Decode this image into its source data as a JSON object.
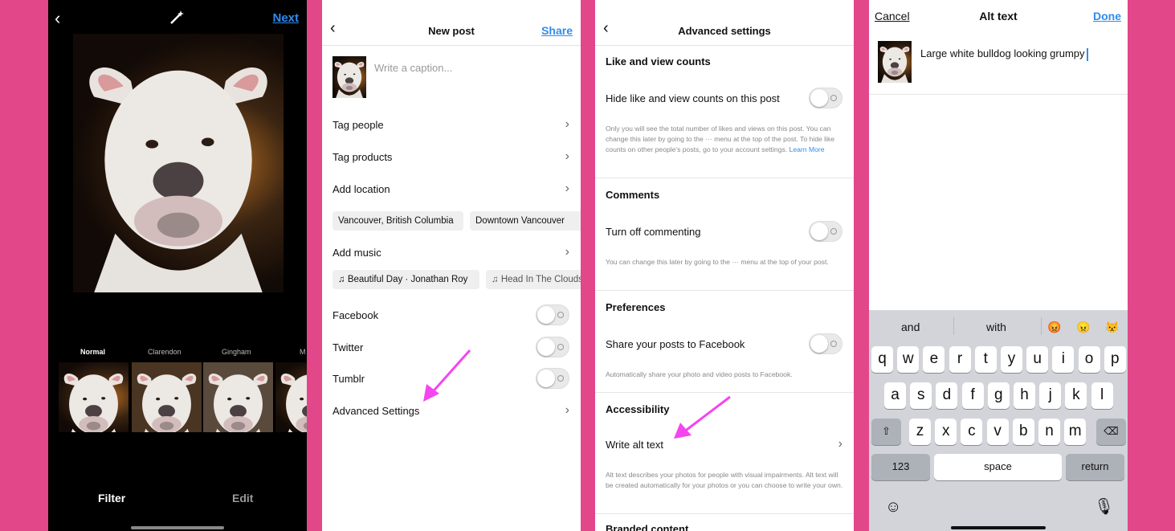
{
  "filter_screen": {
    "next_label": "Next",
    "filters": [
      "Normal",
      "Clarendon",
      "Gingham",
      "M"
    ],
    "tabs": [
      "Filter",
      "Edit"
    ]
  },
  "new_post": {
    "title": "New post",
    "share_label": "Share",
    "caption_placeholder": "Write a caption...",
    "rows": {
      "tag_people": "Tag people",
      "tag_products": "Tag products",
      "add_location": "Add location",
      "add_music": "Add music",
      "facebook": "Facebook",
      "twitter": "Twitter",
      "tumblr": "Tumblr",
      "advanced": "Advanced Settings"
    },
    "location_chips": [
      "Vancouver, British Columbia",
      "Downtown Vancouver"
    ],
    "music_chips": [
      "Beautiful Day · Jonathan Roy",
      "Head In The Clouds"
    ]
  },
  "advanced_settings": {
    "title": "Advanced settings",
    "like_counts": {
      "heading": "Like and view counts",
      "row": "Hide like and view counts on this post",
      "note": "Only you will see the total number of likes and views on this post. You can change this later by going to the ··· menu at the top of the post. To hide like counts on other people's posts, go to your account settings.",
      "link": "Learn More"
    },
    "comments": {
      "heading": "Comments",
      "row": "Turn off commenting",
      "note": "You can change this later by going to the ··· menu at the top of your post."
    },
    "preferences": {
      "heading": "Preferences",
      "row": "Share your posts to Facebook",
      "note": "Automatically share your photo and video posts to Facebook."
    },
    "accessibility": {
      "heading": "Accessibility",
      "row": "Write alt text",
      "note": "Alt text describes your photos for people with visual impairments. Alt text will be created automatically for your photos or you can choose to write your own."
    },
    "branded": {
      "heading": "Branded content"
    }
  },
  "alt_text": {
    "cancel_label": "Cancel",
    "title": "Alt text",
    "done_label": "Done",
    "value": "Large white bulldog looking grumpy",
    "suggestions": [
      "and",
      "with",
      "😡",
      "😠",
      "😾"
    ],
    "keys": {
      "row1": [
        "q",
        "w",
        "e",
        "r",
        "t",
        "y",
        "u",
        "i",
        "o",
        "p"
      ],
      "row2": [
        "a",
        "s",
        "d",
        "f",
        "g",
        "h",
        "j",
        "k",
        "l"
      ],
      "row3": [
        "z",
        "x",
        "c",
        "v",
        "b",
        "n",
        "m"
      ],
      "numbers": "123",
      "space": "space",
      "return": "return"
    }
  },
  "colors": {
    "background": "#e2478a",
    "accent": "#2e8cf0",
    "arrow": "#f445ef"
  }
}
